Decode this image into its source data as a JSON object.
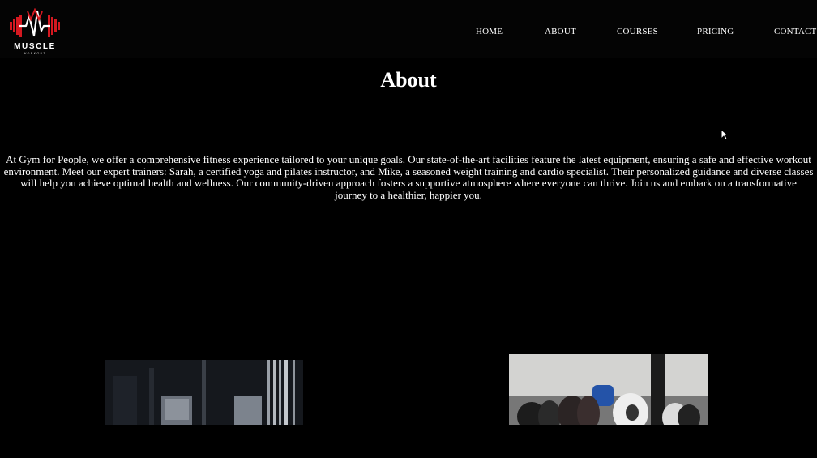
{
  "brand": {
    "name": "MUSCLE",
    "tagline": "WORKOUT",
    "accent_color": "#d41820"
  },
  "nav": {
    "items": [
      "HOME",
      "ABOUT",
      "COURSES",
      "PRICING",
      "CONTACT"
    ]
  },
  "about": {
    "title": "About",
    "body": "At Gym for People, we offer a comprehensive fitness experience tailored to your unique goals. Our state-of-the-art facilities feature the latest equipment, ensuring a safe and effective workout environment. Meet our expert trainers: Sarah, a certified yoga and pilates instructor, and Mike, a seasoned weight training and cardio specialist. Their personalized guidance and diverse classes will help you achieve optimal health and wellness. Our community-driven approach fosters a supportive atmosphere where everyone can thrive. Join us and embark on a transformative journey to a healthier, happier you."
  },
  "images": [
    {
      "subject": "gym-machines"
    },
    {
      "subject": "dumbbells"
    }
  ]
}
